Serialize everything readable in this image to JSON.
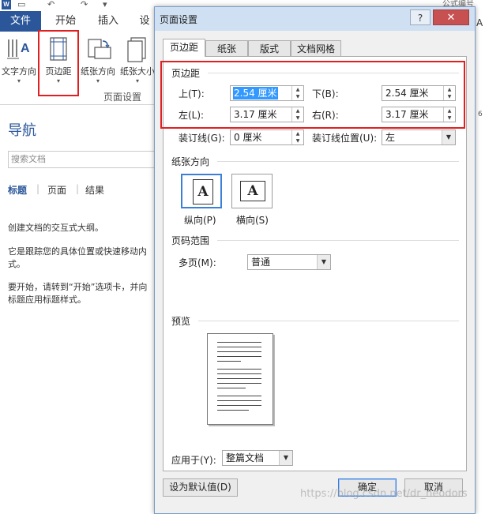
{
  "word_window": {
    "ribbon_tabs": [
      "文件",
      "开始",
      "插入",
      "设"
    ],
    "right_edge": {
      "top_text": "公式编号",
      "letter": "A",
      "num": "6"
    },
    "ribbon_buttons": [
      {
        "label": "文字方向"
      },
      {
        "label": "页边距"
      },
      {
        "label": "纸张方向"
      },
      {
        "label": "纸张大小"
      }
    ],
    "group_label": "页面设置",
    "nav": {
      "title": "导航",
      "search_placeholder": "搜索文档",
      "tabs": [
        "标题",
        "页面",
        "结果"
      ],
      "paragraphs": [
        "创建文档的交互式大纲。",
        "它是跟踪您的具体位置或快速移动内",
        "式。",
        "要开始，请转到“开始”选项卡，并向",
        "标题应用标题样式。"
      ]
    }
  },
  "dialog": {
    "title": "页面设置",
    "help_label": "?",
    "close_label": "✕",
    "tabs": [
      "页边距",
      "纸张",
      "版式",
      "文档网格"
    ],
    "margins": {
      "section": "页边距",
      "top_label": "上(T):",
      "top_value": "2.54 厘米",
      "bottom_label": "下(B):",
      "bottom_value": "2.54 厘米",
      "left_label": "左(L):",
      "left_value": "3.17 厘米",
      "right_label": "右(R):",
      "right_value": "3.17 厘米",
      "gutter_label": "装订线(G):",
      "gutter_value": "0 厘米",
      "gutter_pos_label": "装订线位置(U):",
      "gutter_pos_value": "左"
    },
    "orientation": {
      "section": "纸张方向",
      "icon_letter": "A",
      "portrait_label": "纵向(P)",
      "landscape_label": "横向(S)"
    },
    "pages": {
      "section": "页码范围",
      "multiple_label": "多页(M):",
      "multiple_value": "普通"
    },
    "preview": {
      "section": "预览"
    },
    "apply": {
      "label": "应用于(Y):",
      "value": "整篇文档"
    },
    "buttons": {
      "default": "设为默认值(D)",
      "ok": "确定",
      "cancel": "取消"
    }
  },
  "watermark": "https://blog.csdn.net/dr_heodors",
  "colors": {
    "accent": "#2b579a",
    "highlight": "#e02020",
    "selection": "#3399ff"
  }
}
